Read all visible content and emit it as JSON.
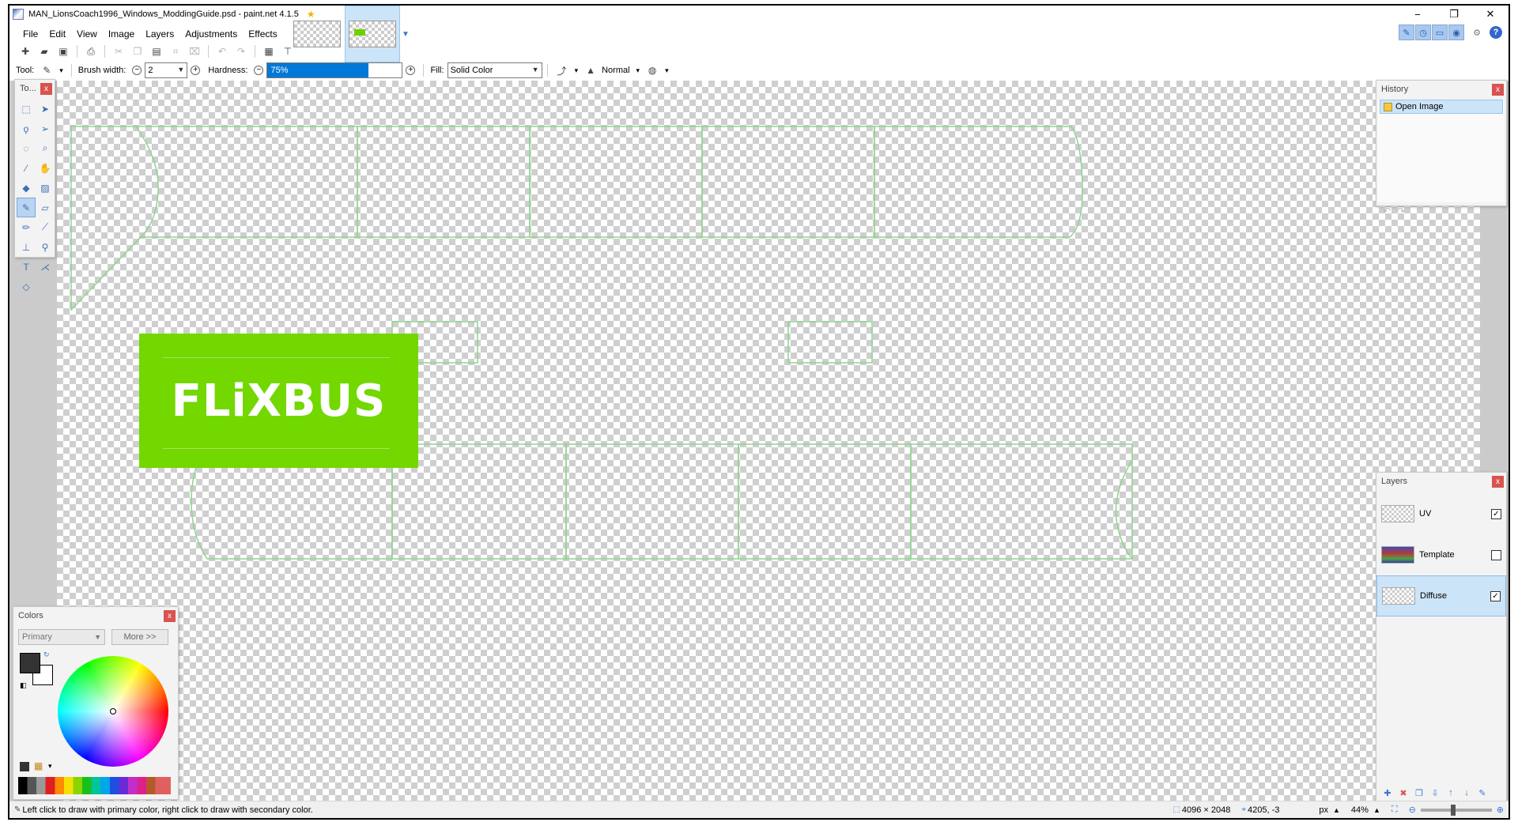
{
  "window": {
    "title": "MAN_LionsCoach1996_Windows_ModdingGuide.psd - paint.net 4.1.5",
    "minimize": "−",
    "maximize": "❐",
    "close": "✕"
  },
  "menu": {
    "file": "File",
    "edit": "Edit",
    "view": "View",
    "image": "Image",
    "layers": "Layers",
    "adjustments": "Adjustments",
    "effects": "Effects"
  },
  "options": {
    "tool_label": "Tool:",
    "brush_width_label": "Brush width:",
    "brush_width_value": "2",
    "hardness_label": "Hardness:",
    "hardness_value": "75%",
    "hardness_fraction": 0.75,
    "fill_label": "Fill:",
    "fill_value": "Solid Color",
    "blend_mode": "Normal"
  },
  "canvas": {
    "logo_text": "FLiXBUS",
    "logo_color": "#73d700",
    "uv_line_color": "#8fd48f"
  },
  "tools_panel": {
    "title": "To..."
  },
  "history_panel": {
    "title": "History",
    "items": [
      "Open Image"
    ]
  },
  "layers_panel": {
    "title": "Layers",
    "layers": [
      {
        "name": "UV",
        "visible": true,
        "selected": false
      },
      {
        "name": "Template",
        "visible": false,
        "selected": false
      },
      {
        "name": "Diffuse",
        "visible": true,
        "selected": true
      }
    ]
  },
  "colors_panel": {
    "title": "Colors",
    "mode": "Primary",
    "more_button": "More >>",
    "primary_color": "#333333",
    "secondary_color": "#ffffff"
  },
  "status": {
    "hint": "Left click to draw with primary color, right click to draw with secondary color.",
    "image_size": "4096 × 2048",
    "cursor_pos": "4205, -3",
    "unit": "px",
    "zoom": "44%"
  }
}
